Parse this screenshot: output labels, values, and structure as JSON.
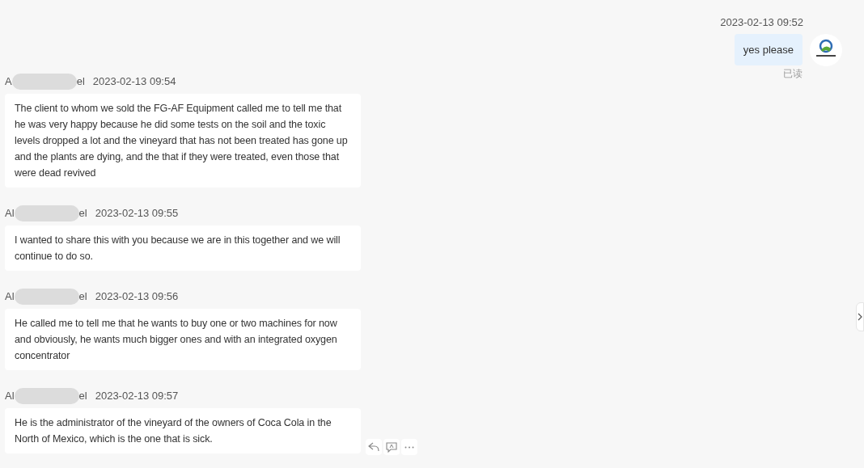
{
  "outgoing": {
    "time": "2023-02-13 09:52",
    "text": "yes please",
    "status": "已读"
  },
  "messages": [
    {
      "name_start": "A",
      "name_end": "el",
      "time": "2023-02-13 09:54",
      "text": "The client to whom we sold the FG-AF Equipment called me to tell me that he was very happy because he did some tests on the soil and the toxic levels dropped a lot and the vineyard that has not been treated has gone up and the plants are dying, and the that if they were treated, even those that were dead revived",
      "hovered": false
    },
    {
      "name_start": "Al",
      "name_end": "el",
      "time": "2023-02-13 09:55",
      "text": "I wanted to share this with you because we are in this together and we will continue to do so.",
      "hovered": false
    },
    {
      "name_start": "Al",
      "name_end": "el",
      "time": "2023-02-13 09:56",
      "text": "He called me to tell me that he wants to buy one or two machines for now and obviously, he wants much bigger ones and with an integrated oxygen concentrator",
      "hovered": false
    },
    {
      "name_start": "Al",
      "name_end": "el",
      "time": "2023-02-13 09:57",
      "text": "He is the administrator of the vineyard of the owners of Coca Cola in the North of Mexico, which is the one that is sick.",
      "hovered": true
    }
  ]
}
